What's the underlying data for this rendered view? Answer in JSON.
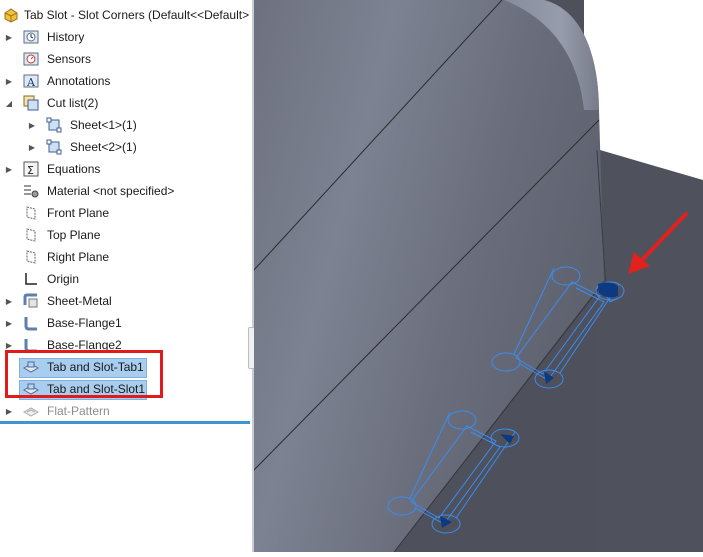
{
  "tree": {
    "root": "Tab Slot - Slot Corners  (Default<<Default>",
    "items": [
      {
        "label": "History",
        "icon": "history-icon",
        "expandable": true
      },
      {
        "label": "Sensors",
        "icon": "sensors-icon",
        "expandable": false
      },
      {
        "label": "Annotations",
        "icon": "annotations-icon",
        "expandable": true
      },
      {
        "label": "Cut list(2)",
        "icon": "cut-list-icon",
        "expandable": true,
        "expanded": true
      },
      {
        "label": "Sheet<1>(1)",
        "icon": "sheet-icon",
        "expandable": true,
        "indent": 1
      },
      {
        "label": "Sheet<2>(1)",
        "icon": "sheet-icon",
        "expandable": true,
        "indent": 1
      },
      {
        "label": "Equations",
        "icon": "equations-icon",
        "expandable": true
      },
      {
        "label": "Material <not specified>",
        "icon": "material-icon",
        "expandable": false
      },
      {
        "label": "Front Plane",
        "icon": "plane-icon",
        "expandable": false
      },
      {
        "label": "Top Plane",
        "icon": "plane-icon",
        "expandable": false
      },
      {
        "label": "Right Plane",
        "icon": "plane-icon",
        "expandable": false
      },
      {
        "label": "Origin",
        "icon": "origin-icon",
        "expandable": false
      },
      {
        "label": "Sheet-Metal",
        "icon": "sheet-metal-icon",
        "expandable": true
      },
      {
        "label": "Base-Flange1",
        "icon": "flange-icon",
        "expandable": true
      },
      {
        "label": "Base-Flange2",
        "icon": "flange-icon",
        "expandable": true
      },
      {
        "label": "Tab and Slot-Tab1",
        "icon": "tab-slot-icon",
        "expandable": false,
        "selected": true
      },
      {
        "label": "Tab and Slot-Slot1",
        "icon": "tab-slot-icon",
        "expandable": false,
        "selected": true
      },
      {
        "label": "Flat-Pattern",
        "icon": "flat-pattern-icon",
        "expandable": true,
        "suppressed": true
      }
    ]
  },
  "colors": {
    "selection": "#a9cdee",
    "highlight_box": "#e11b1b",
    "rollback_bar": "#3d95d1",
    "part_face": "#6a6e7d",
    "background_part": "#4e505b",
    "preview_edges": "#3b8cf0",
    "arrow": "#e0211d"
  }
}
